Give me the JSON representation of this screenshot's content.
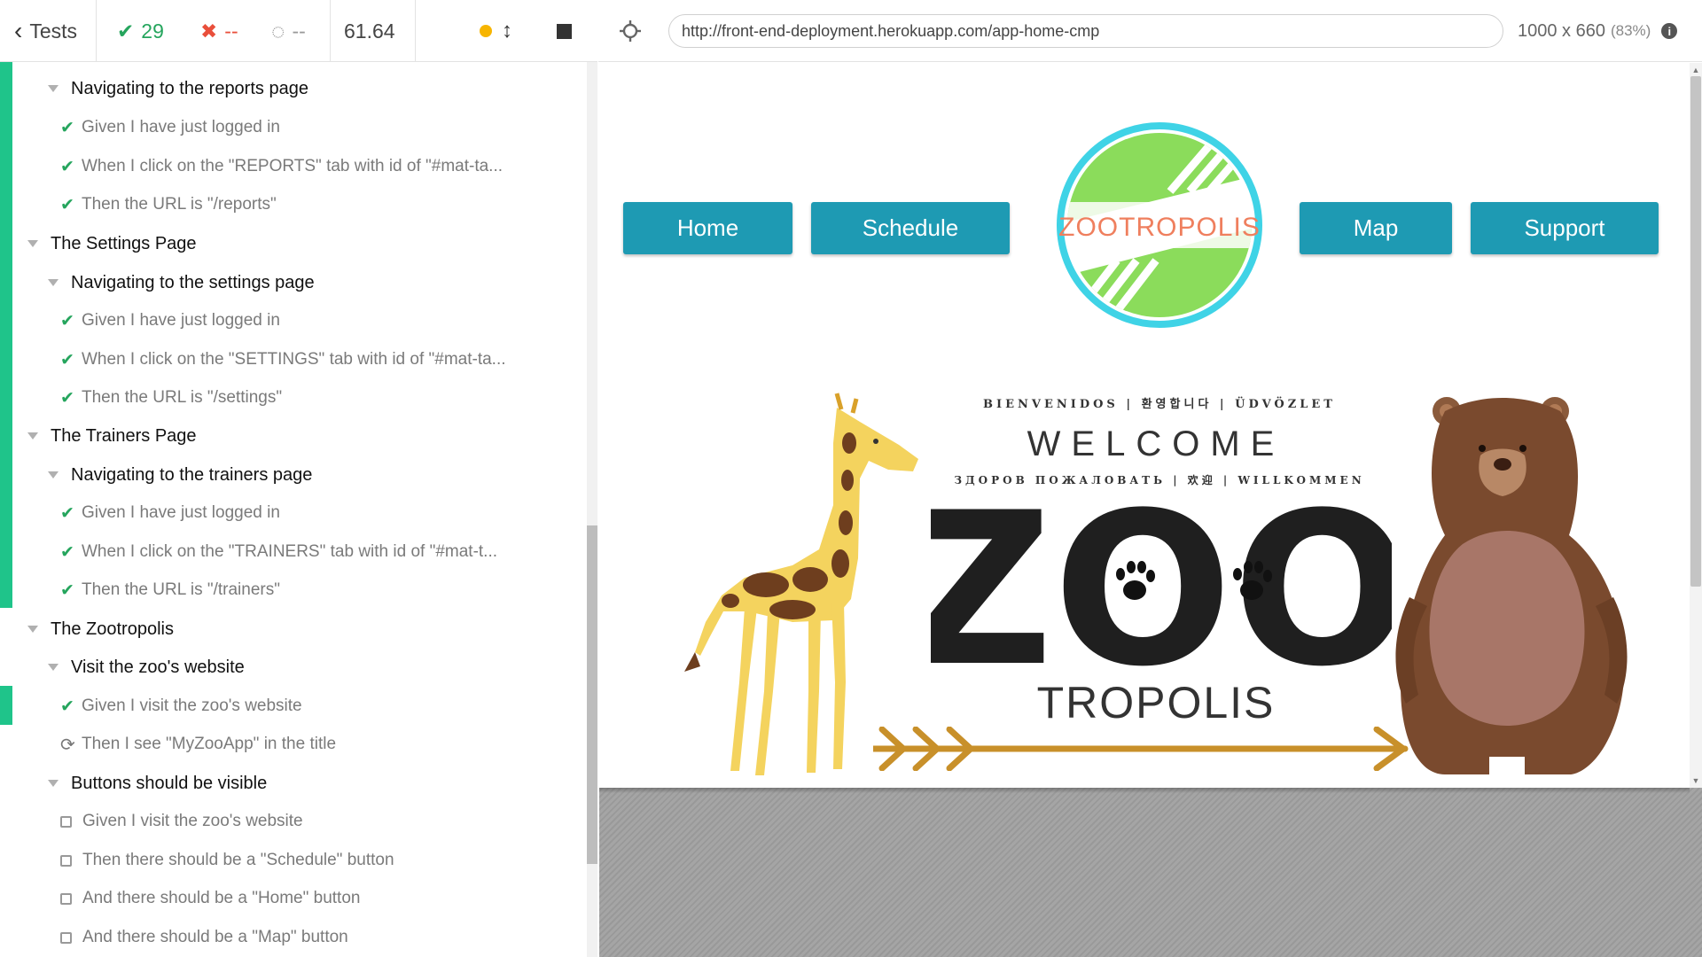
{
  "reporter": {
    "tests_label": "Tests",
    "passed": "29",
    "failed": "--",
    "pending": "--",
    "duration": "61.64",
    "status_color": "#f7b500",
    "pass_color": "#25a55d",
    "fail_color": "#e94f3b",
    "runnables": [
      {
        "kind": "suite",
        "level": 2,
        "title": "Navigating to the reports page"
      },
      {
        "kind": "test",
        "state": "passed",
        "title": "Given I have just logged in"
      },
      {
        "kind": "test",
        "state": "passed",
        "title": "When I click on the \"REPORTS\" tab with id of \"#mat-ta..."
      },
      {
        "kind": "test",
        "state": "passed",
        "title": "Then the URL is \"/reports\""
      },
      {
        "kind": "suite",
        "level": 1,
        "title": "The Settings Page"
      },
      {
        "kind": "suite",
        "level": 2,
        "title": "Navigating to the settings page"
      },
      {
        "kind": "test",
        "state": "passed",
        "title": "Given I have just logged in"
      },
      {
        "kind": "test",
        "state": "passed",
        "title": "When I click on the \"SETTINGS\" tab with id of \"#mat-ta..."
      },
      {
        "kind": "test",
        "state": "passed",
        "title": "Then the URL is \"/settings\""
      },
      {
        "kind": "suite",
        "level": 1,
        "title": "The Trainers Page"
      },
      {
        "kind": "suite",
        "level": 2,
        "title": "Navigating to the trainers page"
      },
      {
        "kind": "test",
        "state": "passed",
        "title": "Given I have just logged in"
      },
      {
        "kind": "test",
        "state": "passed",
        "title": "When I click on the \"TRAINERS\" tab with id of \"#mat-t..."
      },
      {
        "kind": "test",
        "state": "passed",
        "title": "Then the URL is \"/trainers\""
      },
      {
        "kind": "suite",
        "level": 1,
        "title": "The Zootropolis"
      },
      {
        "kind": "suite",
        "level": 2,
        "title": "Visit the zoo's website"
      },
      {
        "kind": "test",
        "state": "passed",
        "title": "Given I visit the zoo's website"
      },
      {
        "kind": "test",
        "state": "running",
        "title": "Then I see \"MyZooApp\" in the title"
      },
      {
        "kind": "suite",
        "level": 2,
        "title": "Buttons should be visible"
      },
      {
        "kind": "test",
        "state": "pending",
        "title": "Given I visit the zoo's website"
      },
      {
        "kind": "test",
        "state": "pending",
        "title": "Then there should be a \"Schedule\" button"
      },
      {
        "kind": "test",
        "state": "pending",
        "title": "And there should be a \"Home\" button"
      },
      {
        "kind": "test",
        "state": "pending",
        "title": "And there should be a \"Map\" button"
      }
    ]
  },
  "aut": {
    "url": "http://front-end-deployment.herokuapp.com/app-home-cmp",
    "viewport": "1000 x 660",
    "scale": "(83%)",
    "page": {
      "nav": {
        "home": "Home",
        "schedule": "Schedule",
        "map": "Map",
        "support": "Support"
      },
      "nav_color": "#1e9ab3",
      "logo_text": "ZOOTROPOLIS",
      "hero": {
        "top_line": "BIENVENIDOS | 환영합니다 | ÜDVÖZLET",
        "welcome": "WELCOME",
        "bottom_line": "ЗДОРОВ ПОЖАЛОВАТЬ | 欢迎 | WILLKOMMEN",
        "zoo": "ZOO",
        "tropolis": "TROPOLIS"
      }
    }
  }
}
